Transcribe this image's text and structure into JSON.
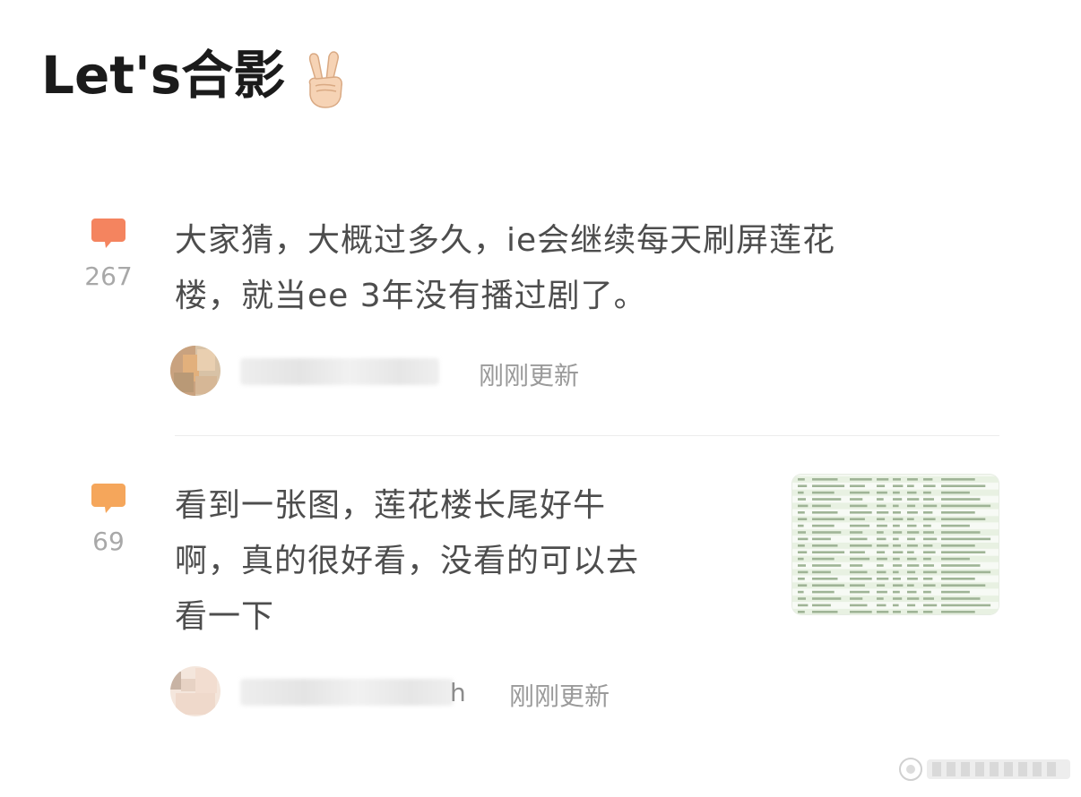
{
  "header": {
    "title": "Let's合影",
    "title_emoji": "victory-hand-emoji"
  },
  "posts": [
    {
      "comment_count": "267",
      "icon_color": "#f4845f",
      "text_lines": [
        "大家猜，大概过多久，ie会继续每天刷屏莲花",
        "楼，就当ee 3年没有播过剧了。"
      ],
      "timestamp": "刚刚更新",
      "username_fragment": ""
    },
    {
      "comment_count": "69",
      "icon_color": "#f5a65b",
      "text_lines": [
        "看到一张图，莲花楼长尾好牛",
        "啊，真的很好看，没看的可以去",
        "看一下"
      ],
      "timestamp": "刚刚更新",
      "username_fragment": "h"
    }
  ]
}
